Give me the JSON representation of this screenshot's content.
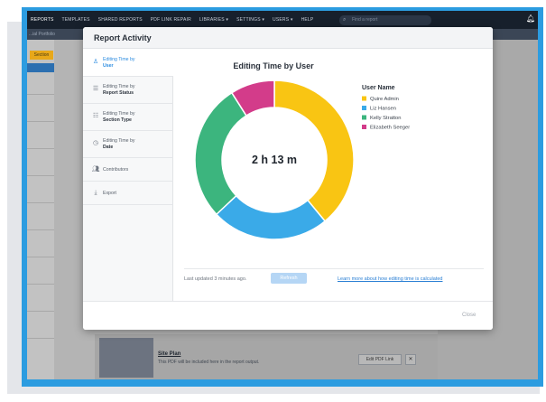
{
  "app": {
    "nav": [
      "REPORTS",
      "TEMPLATES",
      "SHARED REPORTS",
      "PDF LINK REPAIR",
      "LIBRARIES ▾",
      "SETTINGS ▾",
      "USERS ▾",
      "HELP"
    ],
    "search_placeholder": "Find a report",
    "breadcrumb": "...ial Portfolio",
    "section_button": "Section",
    "site_plan_title": "Site Plan",
    "site_plan_sub": "This PDF will be included here in the report output.",
    "edit_pdf_link": "Edit PDF Link",
    "remove_symbol": "✕"
  },
  "modal": {
    "title": "Report Activity",
    "sidebar": [
      {
        "line1": "Editing Time by",
        "line2": "User",
        "icon": "user-icon"
      },
      {
        "line1": "Editing Time by",
        "line2": "Report Status",
        "icon": "status-icon"
      },
      {
        "line1": "Editing Time by",
        "line2": "Section Type",
        "icon": "section-icon"
      },
      {
        "line1": "Editing Time by",
        "line2": "Date",
        "icon": "date-icon"
      },
      {
        "line1": "",
        "line2": "Contributors",
        "icon": "contributors-icon"
      },
      {
        "line1": "",
        "line2": "Export",
        "icon": "export-icon"
      }
    ],
    "updated_text": "Last updated 3 minutes ago.",
    "refresh_label": "Refresh",
    "learn_link": "Learn more about how editing time is calculated",
    "close_label": "Close"
  },
  "chart_data": {
    "type": "pie",
    "title": "Editing Time by User",
    "center_label": "2 h 13 m",
    "legend_title": "User Name",
    "legend_position": "right",
    "categories": [
      "Quire Admin",
      "Liz Hansen",
      "Kelly Stratton",
      "Elizabeth Seeger"
    ],
    "values": [
      39,
      24,
      28,
      9
    ],
    "colors": [
      "#f9c513",
      "#3aaae8",
      "#3cb57e",
      "#d33c8a"
    ]
  }
}
